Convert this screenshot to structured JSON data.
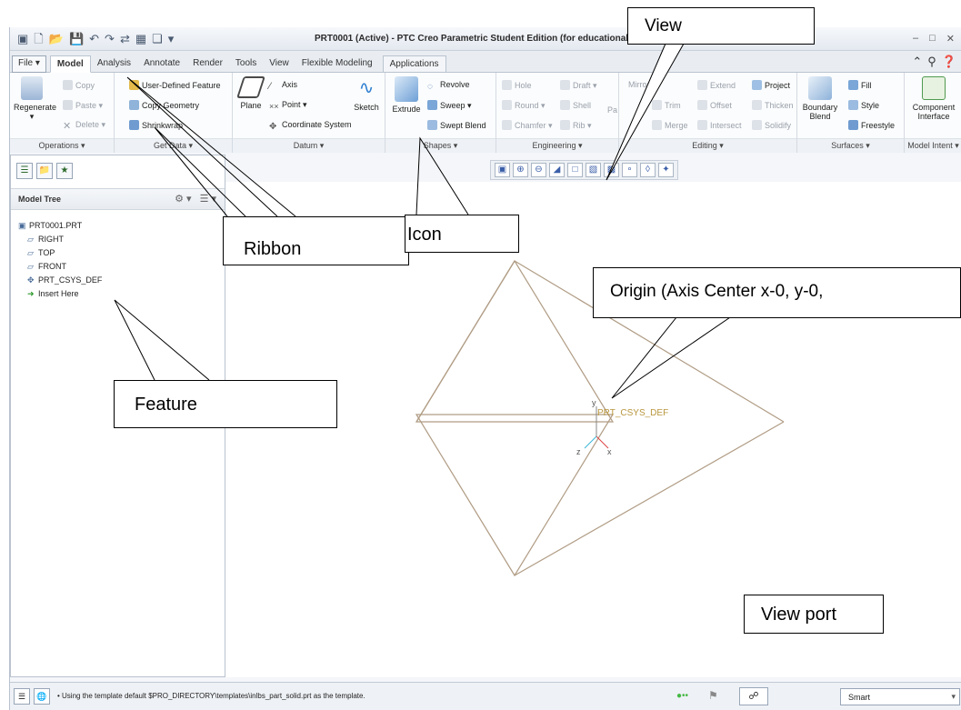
{
  "window": {
    "title": "PRT0001 (Active) - PTC Creo Parametric Student Edition (for educational u",
    "controls": [
      "–",
      "□",
      "✕"
    ]
  },
  "tabs": [
    "File ▾",
    "Model",
    "Analysis",
    "Annotate",
    "Render",
    "Tools",
    "View",
    "Flexible Modeling",
    "Applications"
  ],
  "ribbon": {
    "operations": {
      "regenerate": "Regenerate",
      "copy": "Copy",
      "paste": "Paste ▾",
      "delete": "Delete ▾",
      "label": "Operations ▾"
    },
    "get_data": {
      "udf": "User-Defined Feature",
      "copy_geometry": "Copy Geometry",
      "shrinkwrap": "Shrinkwrap",
      "label": "Get Data ▾"
    },
    "datum": {
      "plane": "Plane",
      "axis": "Axis",
      "point": "Point ▾",
      "csys": "Coordinate System",
      "sketch": "Sketch",
      "label": "Datum ▾"
    },
    "shapes": {
      "extrude": "Extrude",
      "revolve": "Revolve",
      "sweep": "Sweep ▾",
      "swept_blend": "Swept Blend",
      "label": "Shapes ▾"
    },
    "engineering": {
      "hole": "Hole",
      "round": "Round ▾",
      "chamfer": "Chamfer ▾",
      "draft": "Draft ▾",
      "shell": "Shell",
      "rib": "Rib ▾",
      "pattern": "Pa",
      "label": "Engineering ▾"
    },
    "editing": {
      "mirror": "Mirror",
      "trim": "Trim",
      "merge": "Merge",
      "extend": "Extend",
      "offset": "Offset",
      "intersect": "Intersect",
      "project": "Project",
      "thicken": "Thicken",
      "solidify": "Solidify",
      "label": "Editing ▾"
    },
    "surfaces": {
      "boundary": "Boundary",
      "blend": "Blend",
      "fill": "Fill",
      "style": "Style",
      "freestyle": "Freestyle",
      "label": "Surfaces ▾"
    },
    "model_intent": {
      "component": "Component",
      "interface": "Interface",
      "label": "Model Intent ▾"
    }
  },
  "model_tree": {
    "title": "Model Tree",
    "root": "PRT0001.PRT",
    "items": [
      "RIGHT",
      "TOP",
      "FRONT",
      "PRT_CSYS_DEF",
      "Insert Here"
    ]
  },
  "viewport": {
    "csys_label": "PRT_CSYS_DEF",
    "axis_y": "y",
    "axis_z": "z",
    "axis_x": "x"
  },
  "statusbar": {
    "message": "•  Using the template default $PRO_DIRECTORY\\templates\\inlbs_part_solid.prt as the template.",
    "filter": "Smart"
  },
  "annotations": {
    "view": "View",
    "ribbon": "Ribbon",
    "icon": "Icon",
    "origin": "Origin (Axis Center x-0, y-0,",
    "feature": "Feature",
    "view_port": "View port"
  },
  "colors": {
    "datum_plane": "#b09c84",
    "csys_label": "#b8963c",
    "accent": "#3a6fb0"
  }
}
